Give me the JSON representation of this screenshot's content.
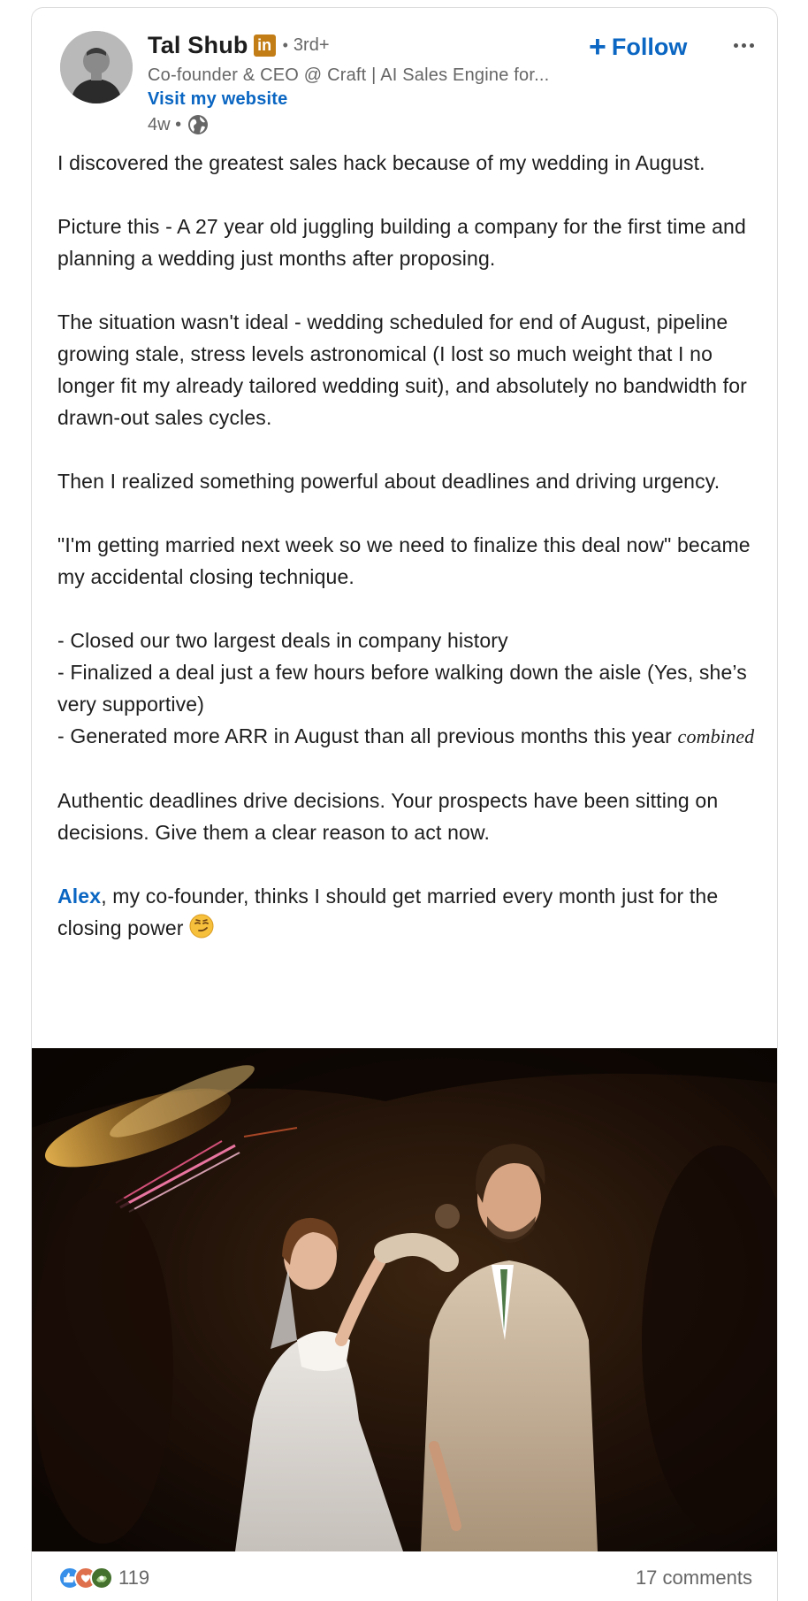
{
  "author": {
    "name": "Tal Shub",
    "badge": "in",
    "degree": "3rd+",
    "separator": "•",
    "headline": "Co-founder & CEO @ Craft | AI Sales Engine for...",
    "website_link": "Visit my website",
    "time": "4w •",
    "visibility_icon": "globe-icon",
    "avatar_icon": "profile-photo"
  },
  "actions": {
    "follow_plus": "+",
    "follow_label": "Follow",
    "more_icon": "more-horizontal-icon"
  },
  "post": {
    "p1": "I discovered the greatest sales hack because of my wedding in August.",
    "p2": "Picture this - A 27 year old juggling building a company for the first time and planning a wedding just months after proposing.",
    "p3": "The situation wasn't ideal - wedding scheduled for end of August, pipeline growing stale, stress levels astronomical (I lost so much weight that I no longer fit my already tailored wedding suit), and absolutely no bandwidth for drawn-out sales cycles.",
    "p4": "Then I realized something powerful about deadlines and driving urgency.",
    "p5": "\"I'm getting married next week so we need to finalize this deal now\" became my accidental closing technique.",
    "bullet1": "- Closed our two largest deals in company history",
    "bullet2": "- Finalized a deal just a few hours before walking down the aisle (Yes, she’s very supportive)",
    "bullet3": "- Generated more ARR in August than all previous months this year",
    "bullet3_italic": "combined",
    "p7": "Authentic deadlines drive decisions. Your prospects have been sitting on decisions. Give them a clear reason to act now.",
    "p8_mention": "Alex",
    "p8_rest": ", my co-founder, thinks I should get married every month just for the closing power ",
    "p8_emoji": "smirking-face-emoji"
  },
  "image": {
    "subject": "wedding-dance-photo"
  },
  "social": {
    "reaction_icons": [
      "like-icon",
      "love-icon",
      "support-icon"
    ],
    "reaction_count": "119",
    "comments": "17 comments"
  },
  "colors": {
    "link_blue": "#0a66c2",
    "text": "#1d1d1d",
    "muted": "#666666",
    "badge": "#c37d16"
  }
}
